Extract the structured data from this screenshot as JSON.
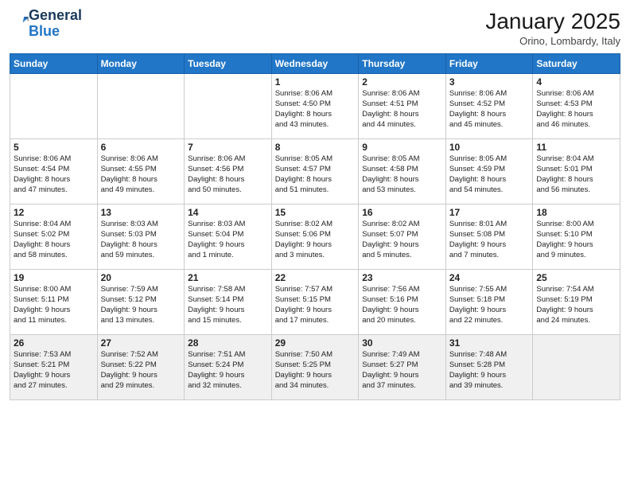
{
  "header": {
    "logo_general": "General",
    "logo_blue": "Blue",
    "month_title": "January 2025",
    "subtitle": "Orino, Lombardy, Italy"
  },
  "days_of_week": [
    "Sunday",
    "Monday",
    "Tuesday",
    "Wednesday",
    "Thursday",
    "Friday",
    "Saturday"
  ],
  "weeks": [
    [
      {
        "day": "",
        "info": ""
      },
      {
        "day": "",
        "info": ""
      },
      {
        "day": "",
        "info": ""
      },
      {
        "day": "1",
        "info": "Sunrise: 8:06 AM\nSunset: 4:50 PM\nDaylight: 8 hours\nand 43 minutes."
      },
      {
        "day": "2",
        "info": "Sunrise: 8:06 AM\nSunset: 4:51 PM\nDaylight: 8 hours\nand 44 minutes."
      },
      {
        "day": "3",
        "info": "Sunrise: 8:06 AM\nSunset: 4:52 PM\nDaylight: 8 hours\nand 45 minutes."
      },
      {
        "day": "4",
        "info": "Sunrise: 8:06 AM\nSunset: 4:53 PM\nDaylight: 8 hours\nand 46 minutes."
      }
    ],
    [
      {
        "day": "5",
        "info": "Sunrise: 8:06 AM\nSunset: 4:54 PM\nDaylight: 8 hours\nand 47 minutes."
      },
      {
        "day": "6",
        "info": "Sunrise: 8:06 AM\nSunset: 4:55 PM\nDaylight: 8 hours\nand 49 minutes."
      },
      {
        "day": "7",
        "info": "Sunrise: 8:06 AM\nSunset: 4:56 PM\nDaylight: 8 hours\nand 50 minutes."
      },
      {
        "day": "8",
        "info": "Sunrise: 8:05 AM\nSunset: 4:57 PM\nDaylight: 8 hours\nand 51 minutes."
      },
      {
        "day": "9",
        "info": "Sunrise: 8:05 AM\nSunset: 4:58 PM\nDaylight: 8 hours\nand 53 minutes."
      },
      {
        "day": "10",
        "info": "Sunrise: 8:05 AM\nSunset: 4:59 PM\nDaylight: 8 hours\nand 54 minutes."
      },
      {
        "day": "11",
        "info": "Sunrise: 8:04 AM\nSunset: 5:01 PM\nDaylight: 8 hours\nand 56 minutes."
      }
    ],
    [
      {
        "day": "12",
        "info": "Sunrise: 8:04 AM\nSunset: 5:02 PM\nDaylight: 8 hours\nand 58 minutes."
      },
      {
        "day": "13",
        "info": "Sunrise: 8:03 AM\nSunset: 5:03 PM\nDaylight: 8 hours\nand 59 minutes."
      },
      {
        "day": "14",
        "info": "Sunrise: 8:03 AM\nSunset: 5:04 PM\nDaylight: 9 hours\nand 1 minute."
      },
      {
        "day": "15",
        "info": "Sunrise: 8:02 AM\nSunset: 5:06 PM\nDaylight: 9 hours\nand 3 minutes."
      },
      {
        "day": "16",
        "info": "Sunrise: 8:02 AM\nSunset: 5:07 PM\nDaylight: 9 hours\nand 5 minutes."
      },
      {
        "day": "17",
        "info": "Sunrise: 8:01 AM\nSunset: 5:08 PM\nDaylight: 9 hours\nand 7 minutes."
      },
      {
        "day": "18",
        "info": "Sunrise: 8:00 AM\nSunset: 5:10 PM\nDaylight: 9 hours\nand 9 minutes."
      }
    ],
    [
      {
        "day": "19",
        "info": "Sunrise: 8:00 AM\nSunset: 5:11 PM\nDaylight: 9 hours\nand 11 minutes."
      },
      {
        "day": "20",
        "info": "Sunrise: 7:59 AM\nSunset: 5:12 PM\nDaylight: 9 hours\nand 13 minutes."
      },
      {
        "day": "21",
        "info": "Sunrise: 7:58 AM\nSunset: 5:14 PM\nDaylight: 9 hours\nand 15 minutes."
      },
      {
        "day": "22",
        "info": "Sunrise: 7:57 AM\nSunset: 5:15 PM\nDaylight: 9 hours\nand 17 minutes."
      },
      {
        "day": "23",
        "info": "Sunrise: 7:56 AM\nSunset: 5:16 PM\nDaylight: 9 hours\nand 20 minutes."
      },
      {
        "day": "24",
        "info": "Sunrise: 7:55 AM\nSunset: 5:18 PM\nDaylight: 9 hours\nand 22 minutes."
      },
      {
        "day": "25",
        "info": "Sunrise: 7:54 AM\nSunset: 5:19 PM\nDaylight: 9 hours\nand 24 minutes."
      }
    ],
    [
      {
        "day": "26",
        "info": "Sunrise: 7:53 AM\nSunset: 5:21 PM\nDaylight: 9 hours\nand 27 minutes."
      },
      {
        "day": "27",
        "info": "Sunrise: 7:52 AM\nSunset: 5:22 PM\nDaylight: 9 hours\nand 29 minutes."
      },
      {
        "day": "28",
        "info": "Sunrise: 7:51 AM\nSunset: 5:24 PM\nDaylight: 9 hours\nand 32 minutes."
      },
      {
        "day": "29",
        "info": "Sunrise: 7:50 AM\nSunset: 5:25 PM\nDaylight: 9 hours\nand 34 minutes."
      },
      {
        "day": "30",
        "info": "Sunrise: 7:49 AM\nSunset: 5:27 PM\nDaylight: 9 hours\nand 37 minutes."
      },
      {
        "day": "31",
        "info": "Sunrise: 7:48 AM\nSunset: 5:28 PM\nDaylight: 9 hours\nand 39 minutes."
      },
      {
        "day": "",
        "info": ""
      }
    ]
  ]
}
